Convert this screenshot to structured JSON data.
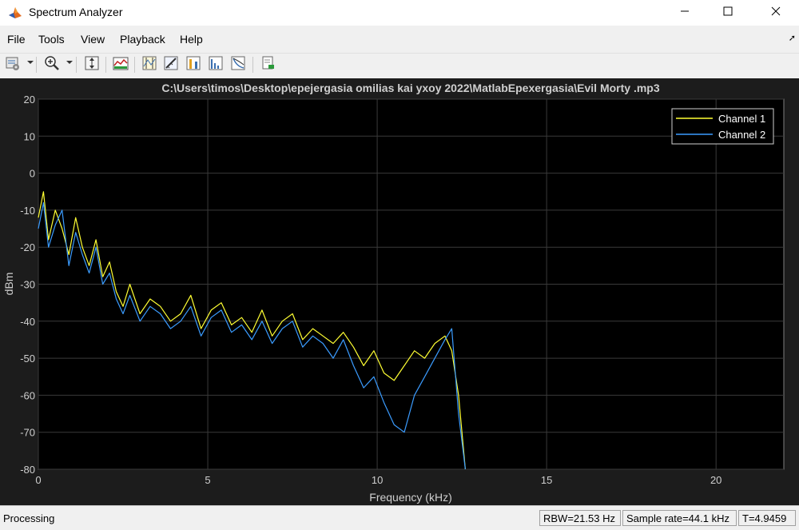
{
  "window": {
    "title": "Spectrum Analyzer",
    "app_icon": "matlab-icon",
    "controls": [
      "minimize-icon",
      "maximize-icon",
      "close-icon"
    ]
  },
  "menu": {
    "items": [
      "File",
      "Tools",
      "View",
      "Playback",
      "Help"
    ]
  },
  "toolbar": {
    "icons": [
      "configuration-properties-icon",
      "zoom-in-icon",
      "scale-axes-icon",
      "spectrum-settings-icon",
      "data-cursor-icon",
      "measurement-icon",
      "peak-finder-icon",
      "distortion-measurements-icon",
      "ccdf-icon",
      "print-icon"
    ]
  },
  "plot": {
    "background": "#1c1c1c",
    "axes_background": "#000000",
    "text_color": "#cfcfcf",
    "grid_color": "#3a3a3a"
  },
  "chart_data": {
    "type": "line",
    "title": "C:\\Users\\timos\\Desktop\\epejergasia omilias kai yxoy 2022\\MatlabEpexergasia\\Evil Morty .mp3",
    "xlabel": "Frequency (kHz)",
    "ylabel": "dBm",
    "xlim": [
      0,
      22
    ],
    "ylim": [
      -80,
      20
    ],
    "xticks": [
      0,
      5,
      10,
      15,
      20
    ],
    "yticks": [
      20,
      10,
      0,
      -10,
      -20,
      -30,
      -40,
      -50,
      -60,
      -70,
      -80
    ],
    "grid": true,
    "legend_position": "top-right",
    "series": [
      {
        "name": "Channel 1",
        "color": "#ffff33",
        "x": [
          0,
          0.15,
          0.3,
          0.5,
          0.7,
          0.9,
          1.1,
          1.3,
          1.5,
          1.7,
          1.9,
          2.1,
          2.3,
          2.5,
          2.7,
          3.0,
          3.3,
          3.6,
          3.9,
          4.2,
          4.5,
          4.8,
          5.1,
          5.4,
          5.7,
          6.0,
          6.3,
          6.6,
          6.9,
          7.2,
          7.5,
          7.8,
          8.1,
          8.4,
          8.7,
          9.0,
          9.3,
          9.6,
          9.9,
          10.2,
          10.5,
          10.8,
          11.1,
          11.4,
          11.7,
          12.0,
          12.2,
          12.4,
          12.6
        ],
        "y": [
          -12,
          -5,
          -18,
          -10,
          -15,
          -22,
          -12,
          -20,
          -25,
          -18,
          -28,
          -24,
          -32,
          -36,
          -30,
          -38,
          -34,
          -36,
          -40,
          -38,
          -33,
          -42,
          -37,
          -35,
          -41,
          -39,
          -43,
          -37,
          -44,
          -40,
          -38,
          -45,
          -42,
          -44,
          -46,
          -43,
          -47,
          -52,
          -48,
          -54,
          -56,
          -52,
          -48,
          -50,
          -46,
          -44,
          -48,
          -60,
          -80
        ]
      },
      {
        "name": "Channel 2",
        "color": "#3b9cff",
        "x": [
          0,
          0.15,
          0.3,
          0.5,
          0.7,
          0.9,
          1.1,
          1.3,
          1.5,
          1.7,
          1.9,
          2.1,
          2.3,
          2.5,
          2.7,
          3.0,
          3.3,
          3.6,
          3.9,
          4.2,
          4.5,
          4.8,
          5.1,
          5.4,
          5.7,
          6.0,
          6.3,
          6.6,
          6.9,
          7.2,
          7.5,
          7.8,
          8.1,
          8.4,
          8.7,
          9.0,
          9.3,
          9.6,
          9.9,
          10.2,
          10.5,
          10.8,
          11.1,
          11.4,
          11.7,
          12.0,
          12.2,
          12.4,
          12.6
        ],
        "y": [
          -15,
          -8,
          -20,
          -14,
          -10,
          -25,
          -16,
          -22,
          -27,
          -20,
          -30,
          -27,
          -34,
          -38,
          -33,
          -40,
          -36,
          -38,
          -42,
          -40,
          -36,
          -44,
          -39,
          -37,
          -43,
          -41,
          -45,
          -40,
          -46,
          -42,
          -40,
          -47,
          -44,
          -46,
          -50,
          -45,
          -52,
          -58,
          -55,
          -62,
          -68,
          -70,
          -60,
          -55,
          -50,
          -45,
          -42,
          -65,
          -80
        ]
      }
    ]
  },
  "status": {
    "main": "Processing",
    "rbw": "RBW=21.53 Hz",
    "sample_rate": "Sample rate=44.1 kHz",
    "time": "T=4.9459"
  }
}
